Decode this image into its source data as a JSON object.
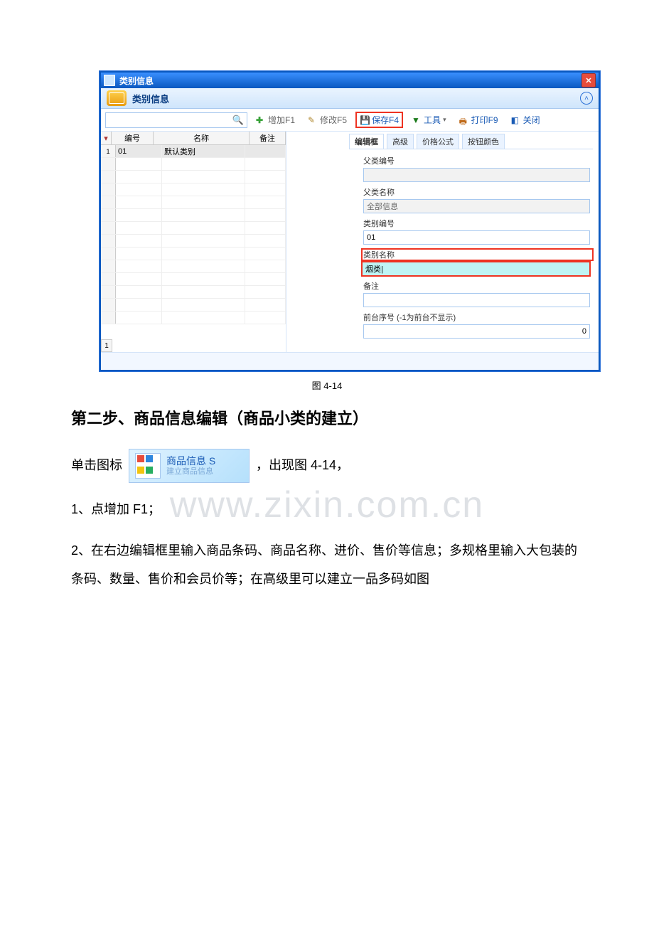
{
  "window": {
    "title": "类别信息"
  },
  "subhead": {
    "title": "类别信息"
  },
  "toolbar": {
    "add": "增加F1",
    "edit": "修改F5",
    "save": "保存F4",
    "tool": "工具",
    "print": "打印F9",
    "close": "关闭"
  },
  "grid": {
    "headers": {
      "col0": "▾",
      "col1": "编号",
      "col2": "名称",
      "col3": "备注"
    },
    "rows": [
      {
        "idx": "1",
        "c1": "01",
        "c2": "默认类别",
        "c3": ""
      }
    ],
    "footer_count": "1"
  },
  "tabs": {
    "t1": "编辑框",
    "t2": "高级",
    "t3": "价格公式",
    "t4": "按钮颜色"
  },
  "form": {
    "parent_code_lbl": "父类编号",
    "parent_code": "",
    "parent_name_lbl": "父类名称",
    "parent_name": "全部信息",
    "code_lbl": "类别编号",
    "code": "01",
    "name_lbl": "类别名称",
    "name": "烟类|",
    "note_lbl": "备注",
    "note": "",
    "seq_lbl": "前台序号 (-1为前台不显示)",
    "seq": "0"
  },
  "doc": {
    "figcap": "图 4-14",
    "h2": "第二步、商品信息编辑（商品小类的建立）",
    "appbtn_t1": "商品信息 S",
    "appbtn_t2": "建立商品信息",
    "p_click_pre": "单击图标",
    "p_click_post": "，出现图 4-14，",
    "li1": "1、点增加 F1；",
    "li2": "2、在右边编辑框里输入商品条码、商品名称、进价、售价等信息；多规格里输入大包装的条码、数量、售价和会员价等；在高级里可以建立一品多码如图"
  },
  "watermark": "www.zixin.com.cn"
}
